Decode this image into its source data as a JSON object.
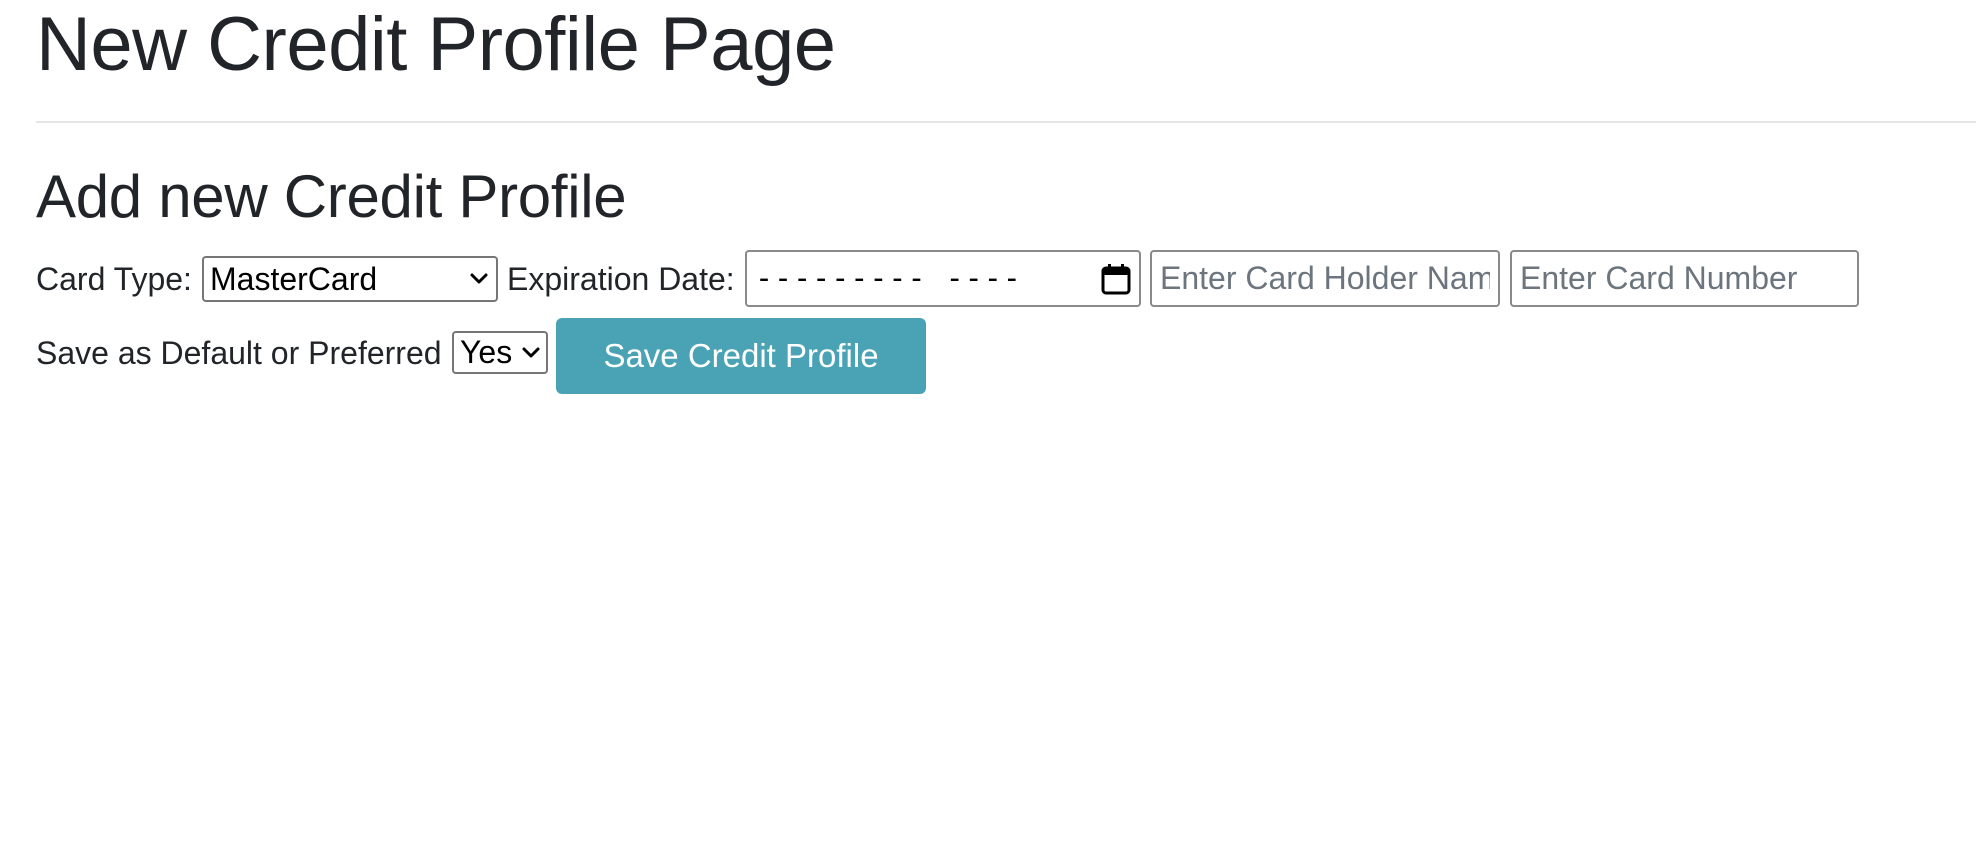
{
  "page": {
    "title": "New Credit Profile Page"
  },
  "form": {
    "heading": "Add new Credit Profile",
    "card_type": {
      "label": "Card Type:",
      "selected": "MasterCard"
    },
    "expiration_date": {
      "label": "Expiration Date:",
      "mask": "--------- ----"
    },
    "card_holder_name": {
      "placeholder": "Enter Card Holder Name",
      "value": ""
    },
    "card_number": {
      "placeholder": "Enter Card Number",
      "value": ""
    },
    "default_preferred": {
      "label": "Save as Default or Preferred",
      "selected": "Yes"
    },
    "save_button_label": "Save Credit Profile"
  },
  "colors": {
    "button_bg": "#4aa3b5",
    "text": "#212529",
    "placeholder": "#6c757d"
  },
  "icons": {
    "calendar": "calendar-icon",
    "dropdown": "chevron-down-icon"
  }
}
